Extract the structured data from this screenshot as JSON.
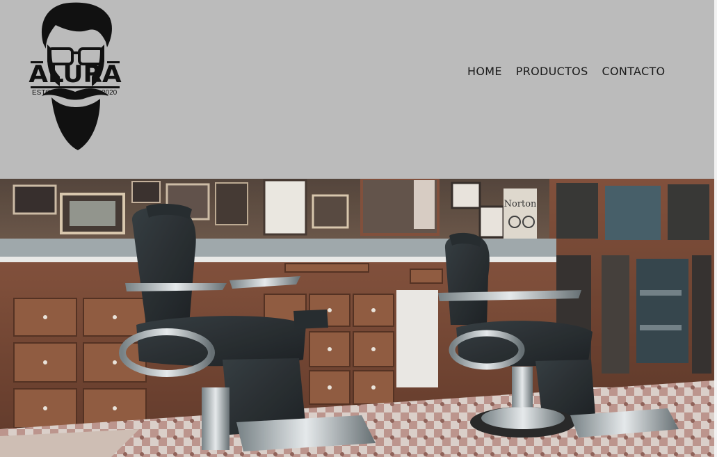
{
  "brand": {
    "name": "ALURA",
    "est_left": "ESTO",
    "est_right": "2020"
  },
  "nav": {
    "items": [
      {
        "label": "HOME"
      },
      {
        "label": "PRODUCTOS"
      },
      {
        "label": "CONTACTO"
      }
    ]
  },
  "hero": {
    "image": "barbershop-interior-photo",
    "poster_text": "Norton"
  },
  "colors": {
    "header_bg": "#bbbbbb",
    "nav_text": "#1a1a1a",
    "logo": "#111111"
  }
}
